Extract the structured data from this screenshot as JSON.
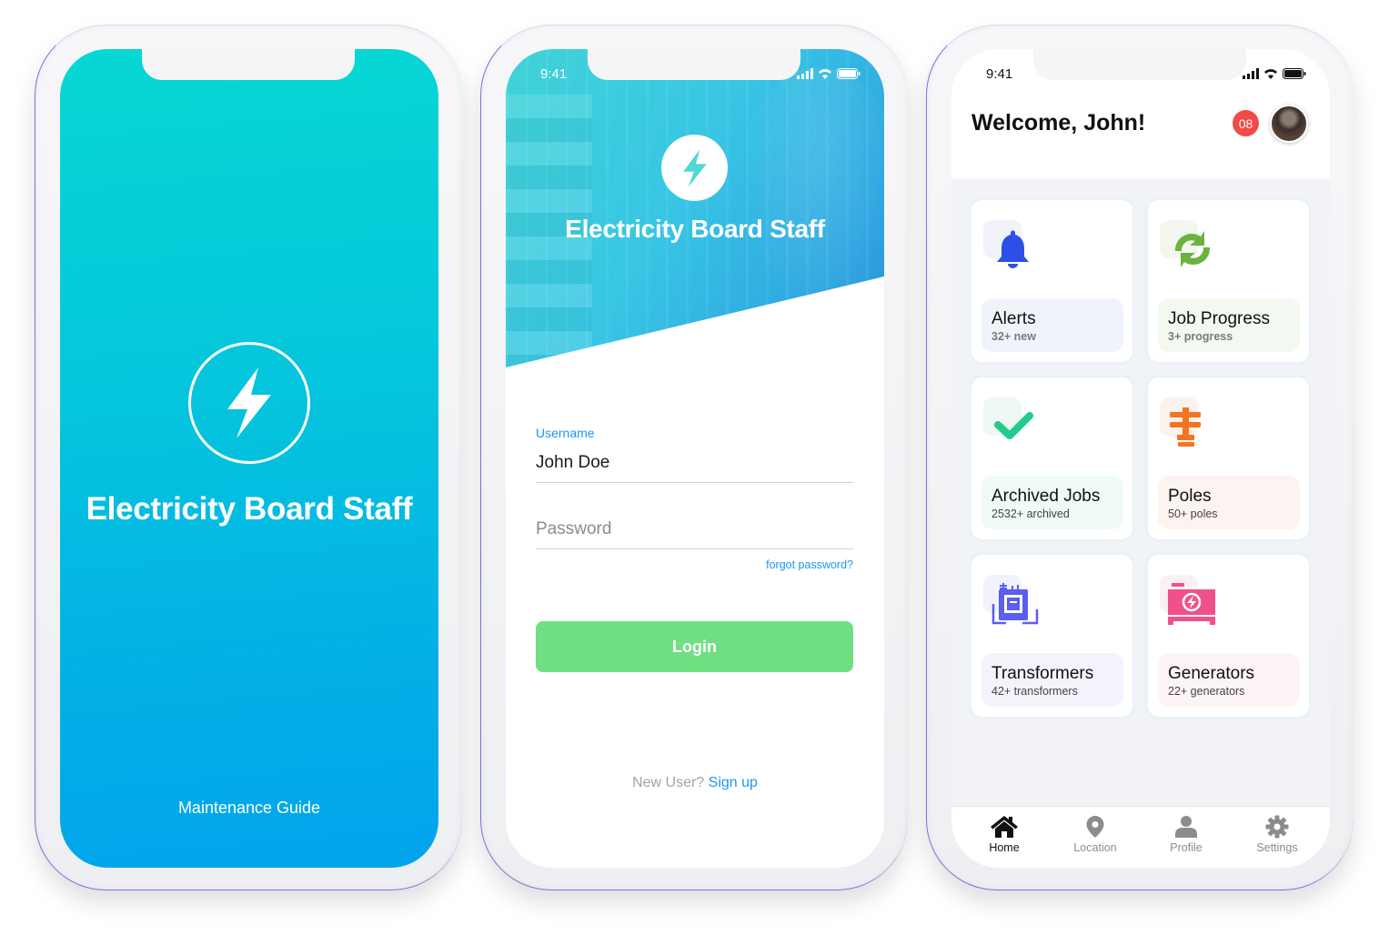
{
  "splash": {
    "app_title": "Electricity Board Staff",
    "subtitle": "Maintenance Guide",
    "logo_icon": "lightning-bolt-icon",
    "gradient_top": "#06d8d3",
    "gradient_bottom": "#02a3ec"
  },
  "login": {
    "status_time": "9:41",
    "app_title": "Electricity Board Staff",
    "username_label": "Username",
    "username_value": "John Doe",
    "password_placeholder": "Password",
    "forgot_password": "forgot password?",
    "login_button": "Login",
    "new_user_text": "New User?",
    "signup_link": "Sign up",
    "accent_color": "#2196f3",
    "button_color": "#6fe082"
  },
  "dashboard": {
    "status_time": "9:41",
    "welcome": "Welcome, John!",
    "notification_count": "08",
    "badge_color": "#f04a4a",
    "cards": [
      {
        "title": "Alerts",
        "subtitle": "32+ new",
        "icon": "bell-icon",
        "color": "#2e4fe6"
      },
      {
        "title": "Job Progress",
        "subtitle": "3+ progress",
        "icon": "sync-icon",
        "color": "#6cb33e"
      },
      {
        "title": "Archived Jobs",
        "subtitle": "2532+ archived",
        "icon": "checkmark-icon",
        "color": "#22cc88"
      },
      {
        "title": "Poles",
        "subtitle": "50+ poles",
        "icon": "utility-pole-icon",
        "color": "#f47421"
      },
      {
        "title": "Transformers",
        "subtitle": "42+ transformers",
        "icon": "transformer-icon",
        "color": "#5b5ef0"
      },
      {
        "title": "Generators",
        "subtitle": "22+ generators",
        "icon": "generator-icon",
        "color": "#f0518a"
      }
    ],
    "tabs": [
      {
        "label": "Home",
        "icon": "home-icon",
        "active": true
      },
      {
        "label": "Location",
        "icon": "location-pin-icon",
        "active": false
      },
      {
        "label": "Profile",
        "icon": "user-icon",
        "active": false
      },
      {
        "label": "Settings",
        "icon": "gear-icon",
        "active": false
      }
    ]
  }
}
